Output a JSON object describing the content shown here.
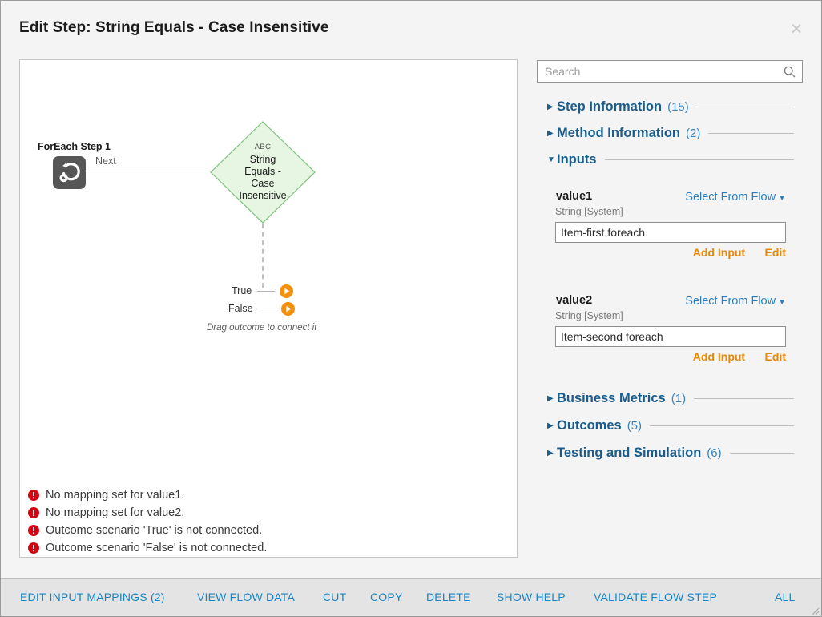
{
  "dialog": {
    "title": "Edit Step: String Equals - Case Insensitive",
    "close_label": "×"
  },
  "canvas": {
    "start_node": {
      "label": "ForEach Step 1",
      "icon": "foreach-loop-icon",
      "connector_label": "Next"
    },
    "step_node": {
      "kind": "ABC",
      "name": "String Equals - Case Insensitive",
      "fill_color": "#e6f6e3",
      "border_color": "#7ec27a"
    },
    "outcomes": [
      {
        "label": "True",
        "icon": "play-circle-icon"
      },
      {
        "label": "False",
        "icon": "play-circle-icon"
      }
    ],
    "drag_hint": "Drag outcome to connect it",
    "messages": [
      {
        "icon": "error-icon",
        "text": "No mapping set for value1."
      },
      {
        "icon": "error-icon",
        "text": "No mapping set for value2."
      },
      {
        "icon": "error-icon",
        "text": "Outcome scenario 'True' is not connected."
      },
      {
        "icon": "error-icon",
        "text": "Outcome scenario 'False' is not connected."
      }
    ],
    "error_color": "#d40511"
  },
  "panel": {
    "search": {
      "placeholder": "Search",
      "value": "",
      "icon": "search-icon"
    },
    "sections": [
      {
        "label": "Step Information",
        "count": "(15)",
        "expanded": false,
        "arrow": "▶"
      },
      {
        "label": "Method Information",
        "count": "(2)",
        "expanded": false,
        "arrow": "▶"
      },
      {
        "label": "Inputs",
        "count": "",
        "expanded": true,
        "arrow": "▼"
      },
      {
        "label": "Business Metrics",
        "count": "(1)",
        "expanded": false,
        "arrow": "▶"
      },
      {
        "label": "Outcomes",
        "count": "(5)",
        "expanded": false,
        "arrow": "▶"
      },
      {
        "label": "Testing and Simulation",
        "count": "(6)",
        "expanded": false,
        "arrow": "▶"
      }
    ],
    "inputs": [
      {
        "name": "value1",
        "type": "String [System]",
        "source_label": "Select From Flow",
        "value": "Item-first foreach",
        "add_label": "Add Input",
        "edit_label": "Edit"
      },
      {
        "name": "value2",
        "type": "String [System]",
        "source_label": "Select From Flow",
        "value": "Item-second foreach",
        "add_label": "Add Input",
        "edit_label": "Edit"
      }
    ],
    "link_color": "#2b7fc0",
    "action_color": "#e8870a",
    "header_color": "#1a5c8b"
  },
  "toolbar": {
    "items": [
      "EDIT INPUT MAPPINGS (2)",
      "VIEW FLOW DATA",
      "CUT",
      "COPY",
      "DELETE",
      "SHOW HELP",
      "VALIDATE FLOW STEP",
      "ALL"
    ],
    "color": "#1886c8"
  }
}
